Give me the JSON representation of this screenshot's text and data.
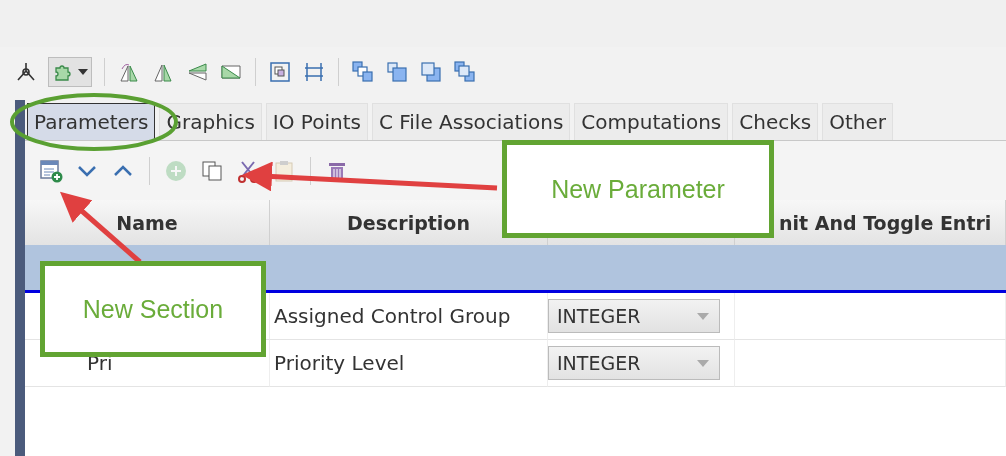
{
  "tabs": [
    {
      "label": "Parameters",
      "selected": true
    },
    {
      "label": "Graphics",
      "selected": false
    },
    {
      "label": "IO Points",
      "selected": false
    },
    {
      "label": "C File Associations",
      "selected": false
    },
    {
      "label": "Computations",
      "selected": false
    },
    {
      "label": "Checks",
      "selected": false
    },
    {
      "label": "Other",
      "selected": false
    }
  ],
  "section_toolbar": [
    {
      "kind": "new-section",
      "disabled": false
    },
    {
      "kind": "down",
      "disabled": false
    },
    {
      "kind": "up",
      "disabled": false
    },
    {
      "kind": "add",
      "disabled": true
    },
    {
      "kind": "copy",
      "disabled": false
    },
    {
      "kind": "cut",
      "disabled": false
    },
    {
      "kind": "paste",
      "disabled": true
    },
    {
      "kind": "delete",
      "disabled": false
    }
  ],
  "table": {
    "columns": [
      {
        "kind": "text",
        "label": "Name"
      },
      {
        "kind": "text",
        "label": "Description"
      },
      {
        "kind": "hidden"
      },
      {
        "kind": "text",
        "label": "nit And Toggle Entri"
      }
    ],
    "rows": [
      {
        "kind": "section",
        "selected": true
      },
      {
        "kind": "parameter",
        "selected": false,
        "description": "Assigned Control Group",
        "type": "INTEGER"
      },
      {
        "kind": "parameter",
        "selected": false,
        "name": "Pri",
        "description": "Priority Level",
        "type": "INTEGER"
      }
    ]
  },
  "callouts": [
    {
      "text": "New Parameter"
    },
    {
      "text": "New Section"
    }
  ]
}
